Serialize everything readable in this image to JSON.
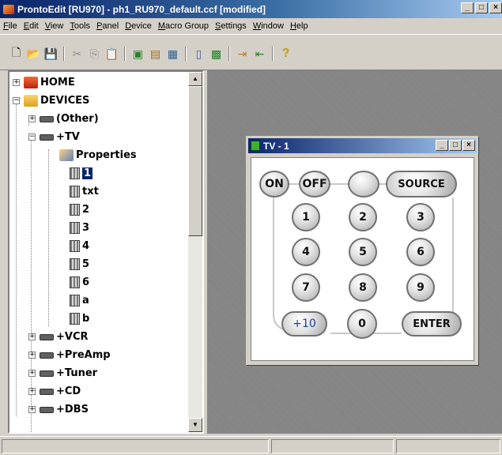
{
  "window": {
    "title": "ProntoEdit [RU970] - ph1_RU970_default.ccf [modified]",
    "min": "_",
    "max": "□",
    "close": "×"
  },
  "menu": [
    "File",
    "Edit",
    "View",
    "Tools",
    "Panel",
    "Device",
    "Macro Group",
    "Settings",
    "Window",
    "Help"
  ],
  "toolbar_icons": [
    "new-icon",
    "open-icon",
    "save-icon",
    "cut-icon",
    "copy-icon",
    "paste-icon",
    "add-device-icon",
    "add-panel-icon",
    "properties-icon",
    "remote-icon",
    "picture-icon",
    "import-icon",
    "export-icon",
    "help-icon"
  ],
  "tree": {
    "home": "HOME",
    "devices": "DEVICES",
    "other": "(Other)",
    "tv": "+TV",
    "properties": "Properties",
    "panels": [
      "1",
      "txt",
      "2",
      "3",
      "4",
      "5",
      "6",
      "a",
      "b"
    ],
    "devices_list": [
      "+VCR",
      "+PreAmp",
      "+Tuner",
      "+CD",
      "+DBS"
    ]
  },
  "panel_window": {
    "title": "TV - 1"
  },
  "remote": {
    "on": "ON",
    "off": "OFF",
    "source": "SOURCE",
    "digits": [
      "1",
      "2",
      "3",
      "4",
      "5",
      "6",
      "7",
      "8",
      "9"
    ],
    "plus10": "+10",
    "zero": "0",
    "enter": "ENTER"
  },
  "colors": {
    "titlebar": "#0a246a",
    "selection": "#0a246a",
    "plus10_text": "#2040a0"
  }
}
